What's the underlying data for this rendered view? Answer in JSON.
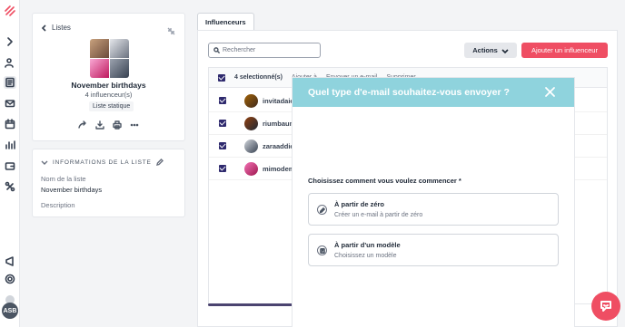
{
  "sidebar": {
    "avatar_initials": "ASB"
  },
  "list_card": {
    "back_label": "Listes",
    "title": "November birthdays",
    "count": "4 influenceur(s)",
    "badge": "Liste statique"
  },
  "info_card": {
    "heading": "INFORMATIONS DE LA LISTE",
    "name_label": "Nom de la liste",
    "name_value": "November birthdays",
    "description_label": "Description"
  },
  "main": {
    "tab": "Influenceurs",
    "search_placeholder": "Rechercher",
    "actions_label": "Actions",
    "add_label": "Ajouter un influenceur",
    "table": {
      "selected": "4 selectionné(s)",
      "add_to": "Ajouter à",
      "send_email": "Envoyer un e-mail",
      "delete": "Supprimer",
      "rows": [
        {
          "name": "invitadaic"
        },
        {
          "name": "riumbaum"
        },
        {
          "name": "zaraaddic"
        },
        {
          "name": "mimodem"
        }
      ]
    }
  },
  "modal": {
    "title": "Quel type d'e-mail souhaitez-vous envoyer ?",
    "prompt": "Choisissez comment vous voulez commencer *",
    "options": [
      {
        "title": "À partir de zéro",
        "desc": "Créer un e-mail à partir de zéro",
        "icon": "pencil-icon"
      },
      {
        "title": "À partir d'un modèle",
        "desc": "Choisissez un modèle",
        "icon": "template-icon"
      }
    ]
  },
  "colors": {
    "accent": "#ef4e63",
    "modal_header": "#8fd3dd",
    "checkbox": "#2f2a6e"
  }
}
